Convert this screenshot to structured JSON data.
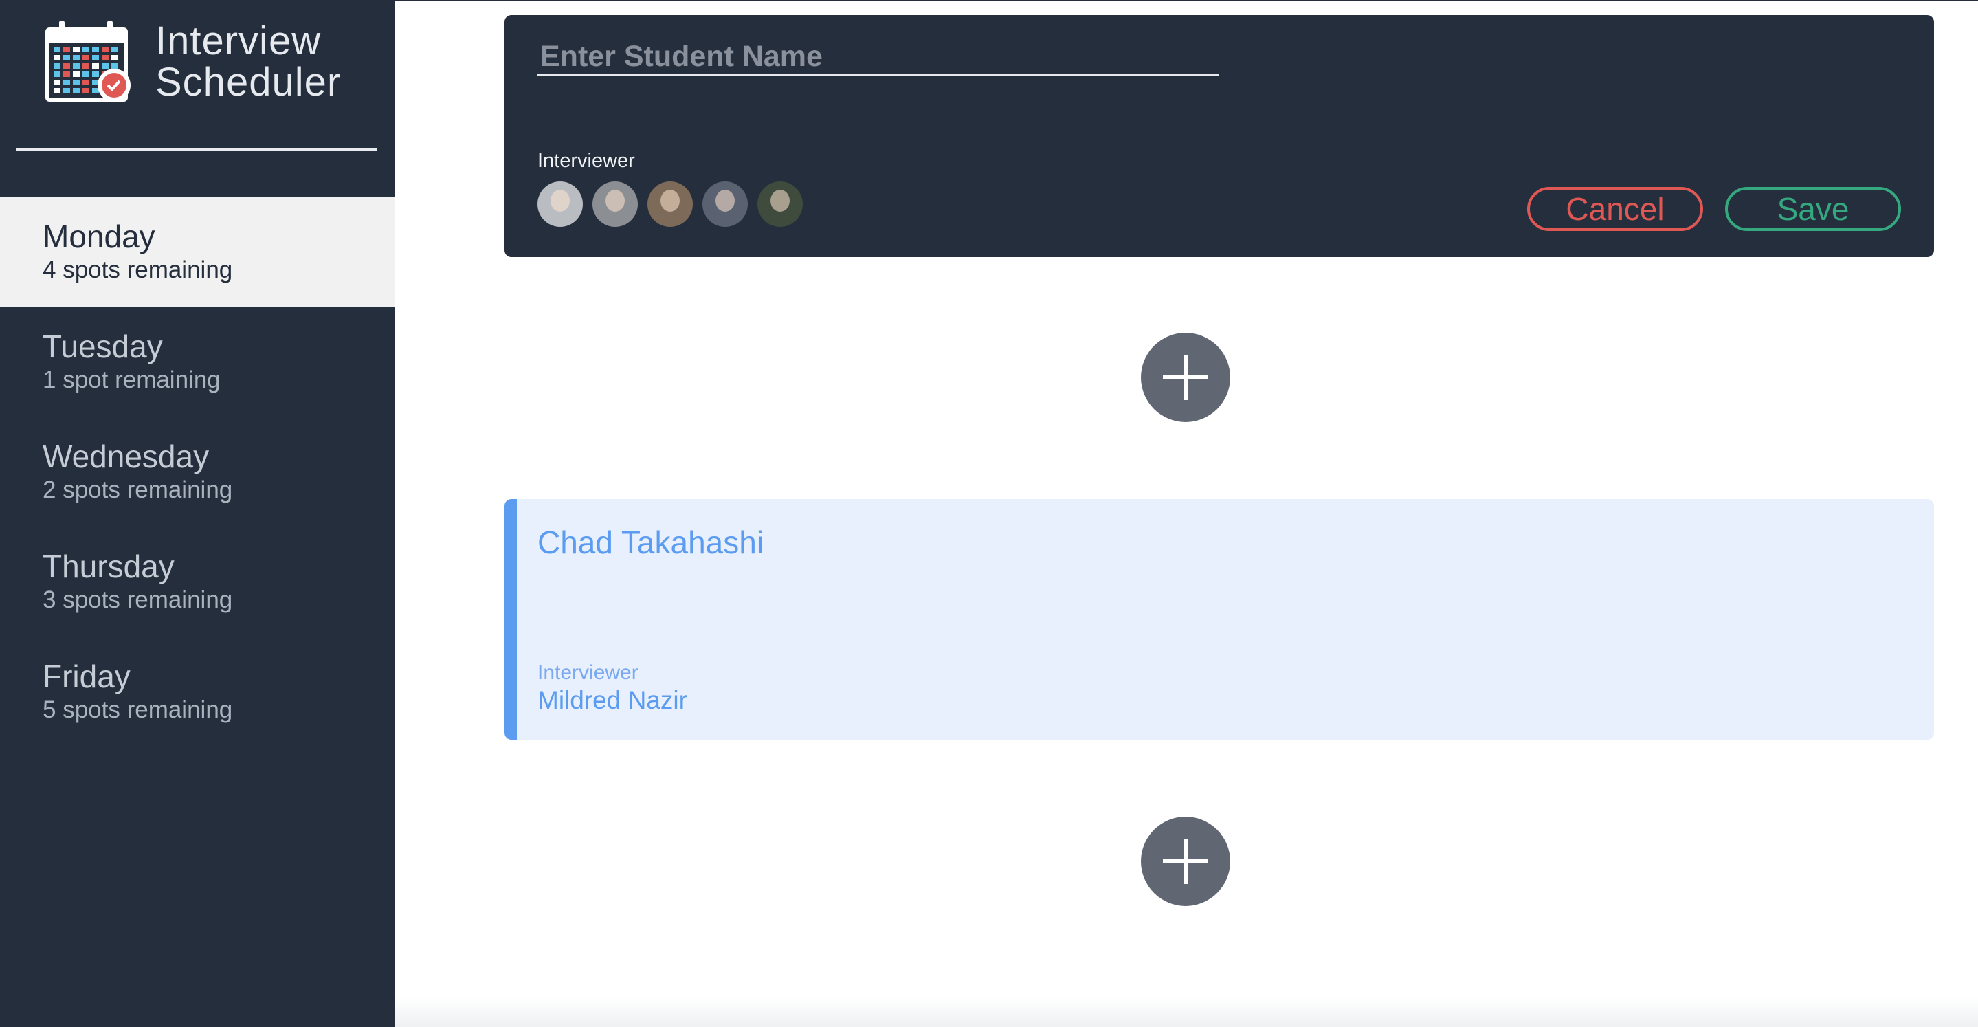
{
  "brand": {
    "line1": "Interview",
    "line2": "Scheduler",
    "icon": "calendar-icon"
  },
  "days": [
    {
      "name": "Monday",
      "spots": "4 spots remaining",
      "selected": true
    },
    {
      "name": "Tuesday",
      "spots": "1 spot remaining",
      "selected": false
    },
    {
      "name": "Wednesday",
      "spots": "2 spots remaining",
      "selected": false
    },
    {
      "name": "Thursday",
      "spots": "3 spots remaining",
      "selected": false
    },
    {
      "name": "Friday",
      "spots": "5 spots remaining",
      "selected": false
    }
  ],
  "form": {
    "student_placeholder": "Enter Student Name",
    "student_value": "",
    "interviewer_label": "Interviewer",
    "avatars": [
      {
        "icon": "interviewer-avatar",
        "color": "#b9bcc0"
      },
      {
        "icon": "interviewer-avatar",
        "color": "#8b8e93"
      },
      {
        "icon": "interviewer-avatar",
        "color": "#7d6a58"
      },
      {
        "icon": "interviewer-avatar",
        "color": "#5a6170"
      },
      {
        "icon": "interviewer-avatar",
        "color": "#3f4b3c"
      }
    ],
    "cancel_label": "Cancel",
    "save_label": "Save"
  },
  "add_button_icon": "plus-icon",
  "appointment": {
    "student": "Chad Takahashi",
    "interviewer_label": "Interviewer",
    "interviewer_name": "Mildred Nazir"
  },
  "colors": {
    "sidebar_bg": "#242e3d",
    "danger": "#e05854",
    "success": "#35a87f",
    "accent_blue": "#5b9bf0",
    "appointment_bg": "#e7f0fc",
    "add_button": "#606773"
  }
}
